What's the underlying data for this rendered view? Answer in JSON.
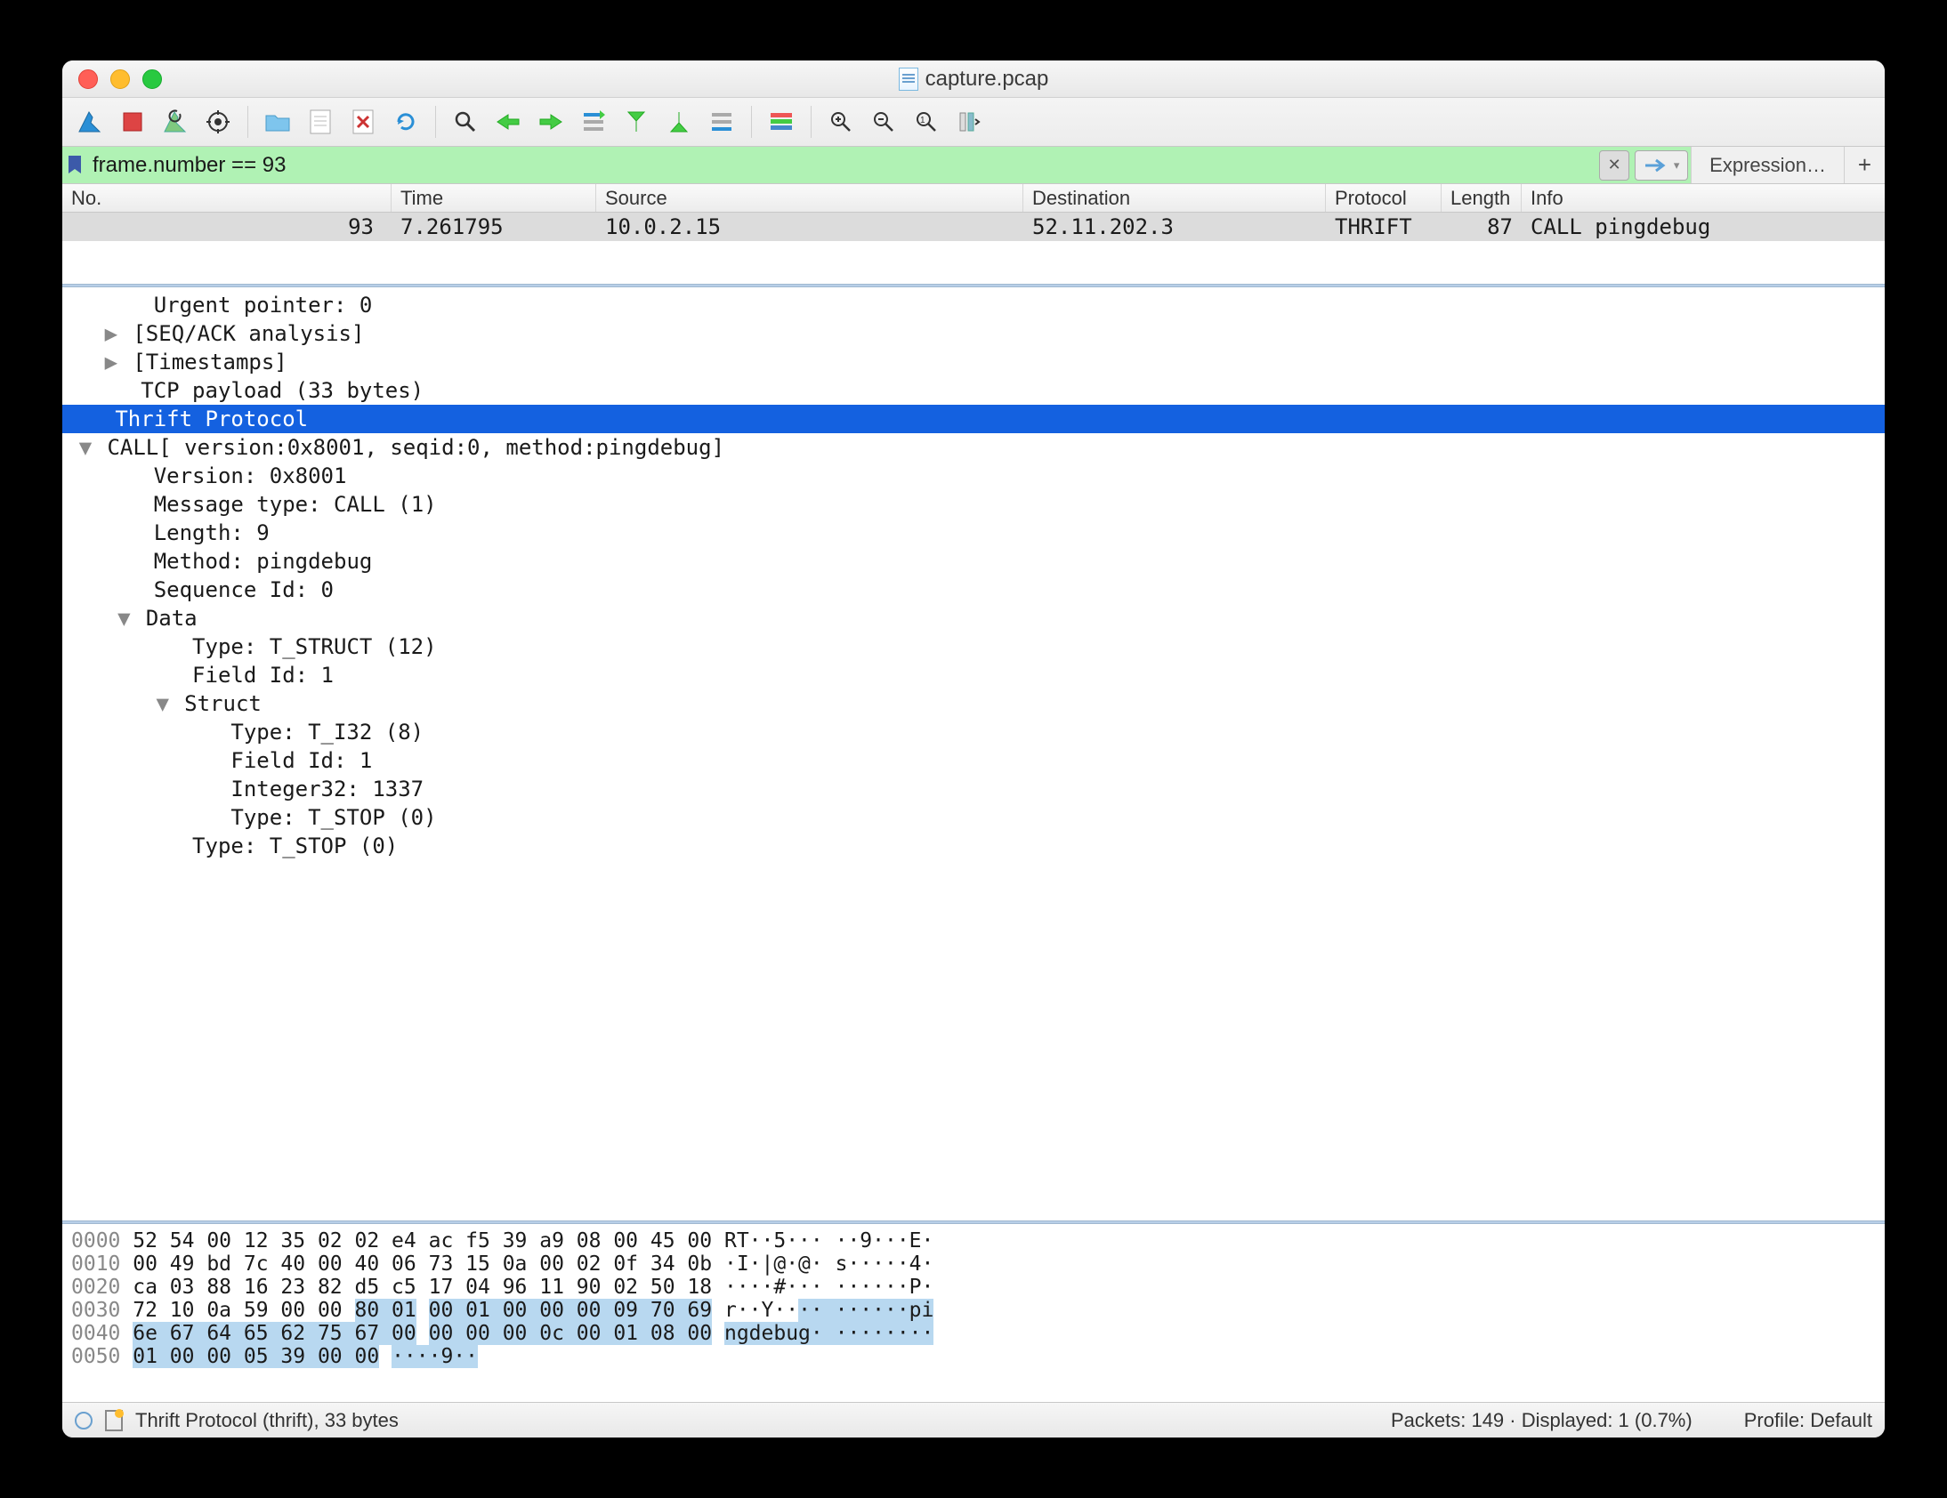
{
  "window": {
    "title": "capture.pcap"
  },
  "filter": {
    "value": "frame.number == 93",
    "expression_label": "Expression…"
  },
  "columns": {
    "no": "No.",
    "time": "Time",
    "source": "Source",
    "destination": "Destination",
    "protocol": "Protocol",
    "length": "Length",
    "info": "Info"
  },
  "packets": [
    {
      "no": "93",
      "time": "7.261795",
      "source": "10.0.2.15",
      "destination": "52.11.202.3",
      "protocol": "THRIFT",
      "length": "87",
      "info": "CALL pingdebug"
    }
  ],
  "details": {
    "urgent": "Urgent pointer: 0",
    "seqack": "[SEQ/ACK analysis]",
    "timestamps": "[Timestamps]",
    "tcp_payload": "TCP payload (33 bytes)",
    "thrift": "Thrift Protocol",
    "call": "CALL[ version:0x8001, seqid:0, method:pingdebug]",
    "version": "Version: 0x8001",
    "msgtype": "Message type: CALL (1)",
    "length": "Length: 9",
    "method": "Method: pingdebug",
    "seqid": "Sequence Id: 0",
    "data": "Data",
    "dtype": "Type: T_STRUCT (12)",
    "fieldid1": "Field Id: 1",
    "struct": "Struct",
    "stype": "Type: T_I32 (8)",
    "sfieldid": "Field Id: 1",
    "int32": "Integer32: 1337",
    "stop1": "Type: T_STOP (0)",
    "stop2": "Type: T_STOP (0)"
  },
  "hex": {
    "rows": [
      {
        "off": "0000",
        "b1": "52 54 00 12 35 02 02 e4",
        "b2": "ac f5 39 a9 08 00 45 00",
        "asc": "RT··5··· ··9···E·"
      },
      {
        "off": "0010",
        "b1": "00 49 bd 7c 40 00 40 06",
        "b2": "73 15 0a 00 02 0f 34 0b",
        "asc": "·I·|@·@· s·····4·"
      },
      {
        "off": "0020",
        "b1": "ca 03 88 16 23 82 d5 c5",
        "b2": "17 04 96 11 90 02 50 18",
        "asc": "····#··· ······P·"
      },
      {
        "off": "0030",
        "b1": "72 10 0a 59 00 00 ",
        "b1h": "80 01",
        "b2h": "00 01 00 00 00 09 70 69",
        "asc1": "r··Y··",
        "asch1": "·· ······pi"
      },
      {
        "off": "0040",
        "b1h": "6e 67 64 65 62 75 67 00",
        "b2h": "00 00 00 0c 00 01 08 00",
        "asch2": "ngdebug· ········"
      },
      {
        "off": "0050",
        "b1h": "01 00 00 05 39 00 00",
        "asch3": "····9··"
      }
    ]
  },
  "status": {
    "left": "Thrift Protocol (thrift), 33 bytes",
    "center": "Packets: 149 · Displayed: 1 (0.7%)",
    "right": "Profile: Default"
  }
}
